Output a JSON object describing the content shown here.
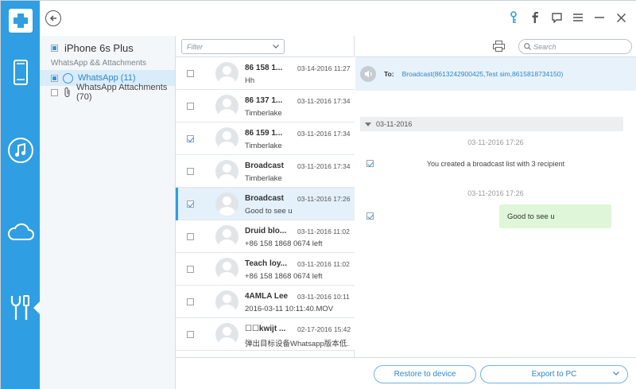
{
  "header": {
    "back_label": "←"
  },
  "device": {
    "name": "iPhone 6s Plus",
    "section_label": "WhatsApp && Attachments",
    "items": [
      {
        "label": "WhatsApp (11)",
        "selected": true
      },
      {
        "label": "WhatsApp Attachments (70)",
        "selected": false
      }
    ]
  },
  "list": {
    "filter_placeholder": "Filter",
    "rows": [
      {
        "name": "86 158 1...",
        "date": "03-14-2016 11:27",
        "preview": "Hh",
        "checked": false
      },
      {
        "name": "86 137 1...",
        "date": "03-11-2016 17:34",
        "preview": "Timberlake",
        "checked": false
      },
      {
        "name": "86 159 1...",
        "date": "03-11-2016 17:34",
        "preview": "Timberlake",
        "checked": true
      },
      {
        "name": "Broadcast",
        "date": "03-11-2016 17:34",
        "preview": "Timberlake",
        "checked": false
      },
      {
        "name": "Broadcast",
        "date": "03-11-2016 17:26",
        "preview": "Good to see u",
        "checked": true
      },
      {
        "name": "Druid blo...",
        "date": "03-11-2016 11:02",
        "preview": "+86 158 1868 0674 left",
        "checked": false
      },
      {
        "name": "Teach loy...",
        "date": "03-11-2016 11:02",
        "preview": "+86 158 1868 0674 left",
        "checked": false
      },
      {
        "name": "4AMLA Lee",
        "date": "03-11-2016 10:11",
        "preview": "2016-03-11 10:11:40.MOV",
        "checked": false
      },
      {
        "name": "☐☐kwijt ...",
        "date": "02-17-2016 15:42",
        "preview": "弹出目标设备Whatsapp版本低...",
        "checked": false
      }
    ]
  },
  "detail": {
    "search_placeholder": "Search",
    "to_label": "To:",
    "recipients": "Broadcast(8613242900425,Test sim,8615818734150)",
    "day": "03-11-2016",
    "timestamp1": "03-11-2016 17:26",
    "system_message": "You created a broadcast list with 3 recipient",
    "timestamp2": "03-11-2016 17:26",
    "bubble_text": "Good to see u"
  },
  "footer": {
    "restore_label": "Restore to device",
    "export_label": "Export to PC"
  },
  "colors": {
    "rail": "#2f9ee3",
    "accent": "#2f86c8",
    "bubble": "#dff6d8",
    "selection": "#e4f1fb"
  }
}
